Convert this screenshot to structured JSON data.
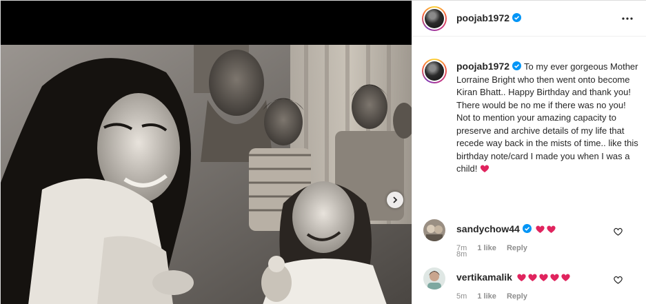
{
  "post": {
    "username": "poojab1972",
    "verified": true,
    "caption": "To my ever gorgeous Mother Lorraine Bright who then went onto become Kiran Bhatt.. Happy Birthday and thank you! There would be no me if there was no you! Not to mention your amazing capacity to preserve and archive details of my life that recede way back in the mists of time.. like this birthday note/card I made you when I was a child!",
    "caption_time": "8m"
  },
  "comments": [
    {
      "username": "sandychow44",
      "verified": true,
      "hearts": 2,
      "time": "7m",
      "likes": "1 like",
      "reply_label": "Reply"
    },
    {
      "username": "vertikamalik",
      "verified": false,
      "hearts": 5,
      "time": "5m",
      "likes": "1 like",
      "reply_label": "Reply"
    }
  ],
  "icons": {
    "verified": "verified-badge-icon",
    "more": "more-options-icon",
    "next": "chevron-right-icon",
    "heart": "heart-outline-icon",
    "heart_emoji": "red-heart-emoji"
  },
  "colors": {
    "verified": "#0095f6",
    "heart_emoji": "#e0245e",
    "muted": "#8e8e8e"
  }
}
